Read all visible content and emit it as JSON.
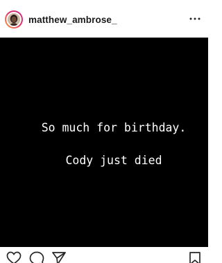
{
  "header": {
    "username": "matthew_ambrose_",
    "more_icon": "more-horizontal-icon"
  },
  "post": {
    "background_color": "#000000",
    "text_color": "#ffffff",
    "lines": [
      "So much for birthday.",
      "Cody just died"
    ]
  },
  "actions": {
    "icons": [
      "heart-icon",
      "comment-icon",
      "share-icon",
      "bookmark-icon"
    ]
  }
}
